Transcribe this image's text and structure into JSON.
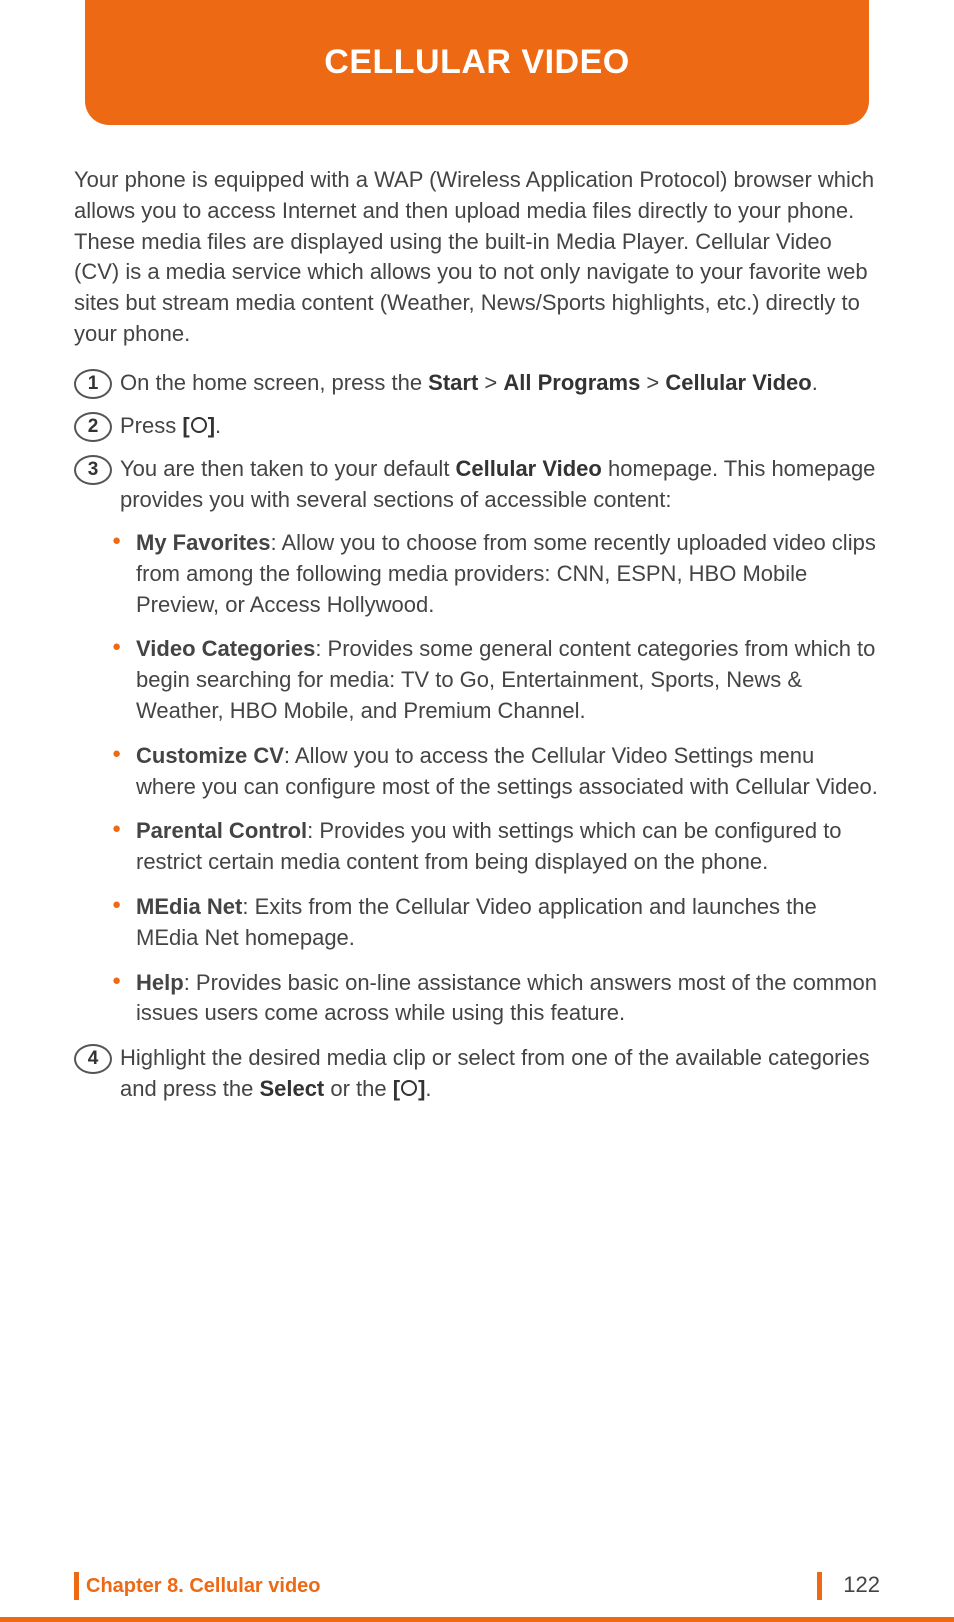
{
  "header": {
    "title": "CELLULAR VIDEO"
  },
  "intro": "Your phone is equipped with a WAP (Wireless Application Protocol) browser which allows you to access Internet and then upload media files directly to your phone. These media files are displayed using the built-in Media Player. Cellular Video (CV) is a media service which allows you to not only navigate to your favorite web sites but stream media content (Weather, News/Sports highlights, etc.) directly to your phone.",
  "steps": {
    "s1": {
      "num": "1",
      "pre": "On the home screen, press the ",
      "b1": "Start",
      "sep1": " > ",
      "b2": "All Programs",
      "sep2": " > ",
      "b3": "Cellular Video",
      "post": "."
    },
    "s2": {
      "num": "2",
      "pre": "Press ",
      "br1": "[",
      "br2": "]",
      "post": "."
    },
    "s3": {
      "num": "3",
      "pre": "You are then taken to your default ",
      "b1": "Cellular Video",
      "post": " homepage. This homepage provides you with several sections of accessible content:"
    },
    "s4": {
      "num": "4",
      "pre": "Highlight the desired media clip or select from one of the available categories and press the ",
      "b1": "Select",
      "mid": " or the ",
      "br1": "[",
      "br2": "]",
      "post": "."
    }
  },
  "sub": {
    "i1": {
      "b": "My Favorites",
      "t": ": Allow you to choose from some recently uploaded video clips from among the following media providers: CNN, ESPN, HBO Mobile Preview, or Access Hollywood."
    },
    "i2": {
      "b": "Video Categories",
      "t": ": Provides some general content categories from which to begin searching for media: TV to Go, Entertainment, Sports, News & Weather, HBO Mobile, and Premium Channel."
    },
    "i3": {
      "b": "Customize CV",
      "t": ": Allow you to access the Cellular Video Settings menu where you can configure most of the settings associated with Cellular Video."
    },
    "i4": {
      "b": "Parental Control",
      "t": ": Provides you with settings which can be configured to restrict certain media content from being displayed on the phone."
    },
    "i5": {
      "b": "MEdia Net",
      "t": ": Exits from the Cellular Video application and launches the MEdia Net homepage."
    },
    "i6": {
      "b": "Help",
      "t": ": Provides basic on-line assistance which answers most of the common issues users come across while using this feature."
    }
  },
  "footer": {
    "chapter": "Chapter 8. Cellular video",
    "page": "122"
  }
}
